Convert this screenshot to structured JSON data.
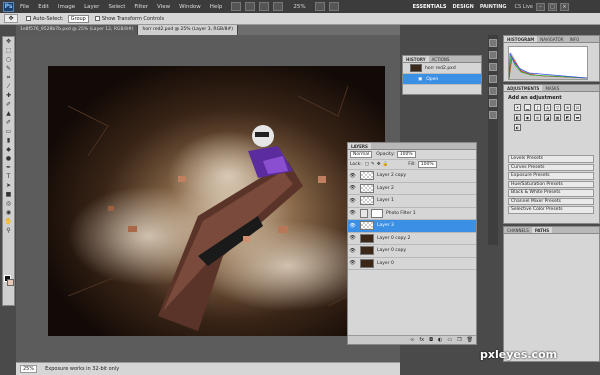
{
  "app": {
    "logo": "Ps",
    "menu": [
      "File",
      "Edit",
      "Image",
      "Layer",
      "Select",
      "Filter",
      "View",
      "Window",
      "Help"
    ],
    "zoom_top": "25%",
    "workspaces": [
      "ESSENTIALS",
      "DESIGN",
      "PAINTING"
    ],
    "cslive": "CS Live"
  },
  "options": {
    "tool_icon": "move-icon",
    "auto_select_label": "Auto-Select:",
    "auto_select_value": "Group",
    "transform_label": "Show Transform Controls"
  },
  "tabs": [
    "1e8f576_9528b7b.pxd @ 25% (Layer 12, RGB/8#)",
    "horr red2.pxd @ 25% (Layer 3, RGB/8#)"
  ],
  "status": {
    "zoom": "25%",
    "message": "Exposure works in 32-bit only"
  },
  "history": {
    "tabs": [
      "HISTORY",
      "ACTIONS"
    ],
    "items": [
      {
        "label": "horr red2.pxd"
      },
      {
        "label": "Open"
      }
    ]
  },
  "layers": {
    "tab": "LAYERS",
    "blend": "Normal",
    "opacity_label": "Opacity:",
    "opacity": "100%",
    "lock_label": "Lock:",
    "fill_label": "Fill:",
    "fill": "100%",
    "rows": [
      {
        "name": "Layer 2 copy",
        "thumb": "empty",
        "selected": false
      },
      {
        "name": "Layer 2",
        "thumb": "empty",
        "selected": false
      },
      {
        "name": "Layer 1",
        "thumb": "empty",
        "selected": false
      },
      {
        "name": "Photo Filter 1",
        "thumb": "adj",
        "selected": false
      },
      {
        "name": "Layer 3",
        "thumb": "empty",
        "selected": true
      },
      {
        "name": "Layer 0 copy 2",
        "thumb": "img",
        "selected": false
      },
      {
        "name": "Layer 0 copy",
        "thumb": "img",
        "selected": false
      },
      {
        "name": "Layer 0",
        "thumb": "img",
        "selected": false
      }
    ]
  },
  "histogram": {
    "tabs": [
      "HISTOGRAM",
      "NAVIGATOR",
      "INFO"
    ]
  },
  "adjust": {
    "tabs": [
      "ADJUSTMENTS",
      "MASKS"
    ],
    "heading": "Add an adjustment",
    "presets": [
      "Levels Presets",
      "Curves Presets",
      "Exposure Presets",
      "Hue/Saturation Presets",
      "Black & White Presets",
      "Channel Mixer Presets",
      "Selective Color Presets"
    ]
  },
  "channels": {
    "tabs": [
      "CHANNELS",
      "PATHS"
    ]
  },
  "watermark": "pxleyes.com"
}
